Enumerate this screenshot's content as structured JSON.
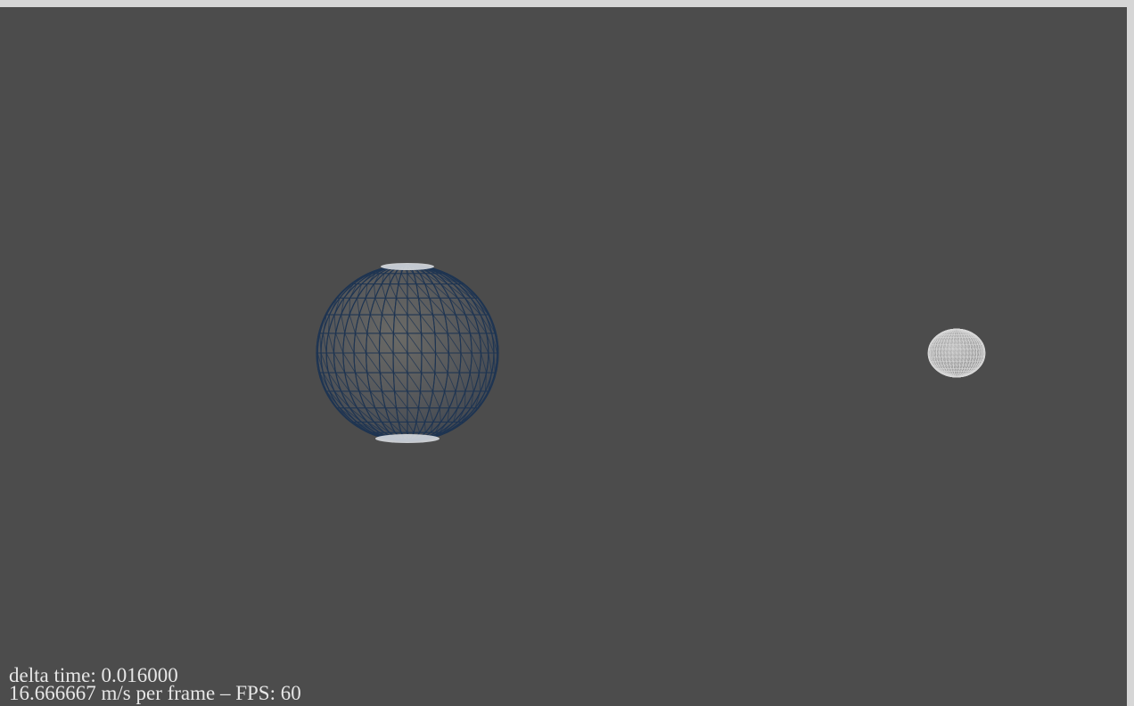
{
  "hud": {
    "delta_time": "delta time: 0.016000",
    "stats": "16.666667 m/s per frame – FPS: 60"
  },
  "colors": {
    "background": "#4c4c4c",
    "frame": "#d6d6d6",
    "planet_wire": "#1f3552",
    "moon_wire": "#d9d9d9",
    "hud_text": "#e6e6e6"
  },
  "scene": {
    "planet": {
      "name": "planet-sphere",
      "latitudes": 14,
      "longitudes": 20
    },
    "moon": {
      "name": "moon-sphere",
      "latitudes": 18,
      "longitudes": 24
    }
  }
}
